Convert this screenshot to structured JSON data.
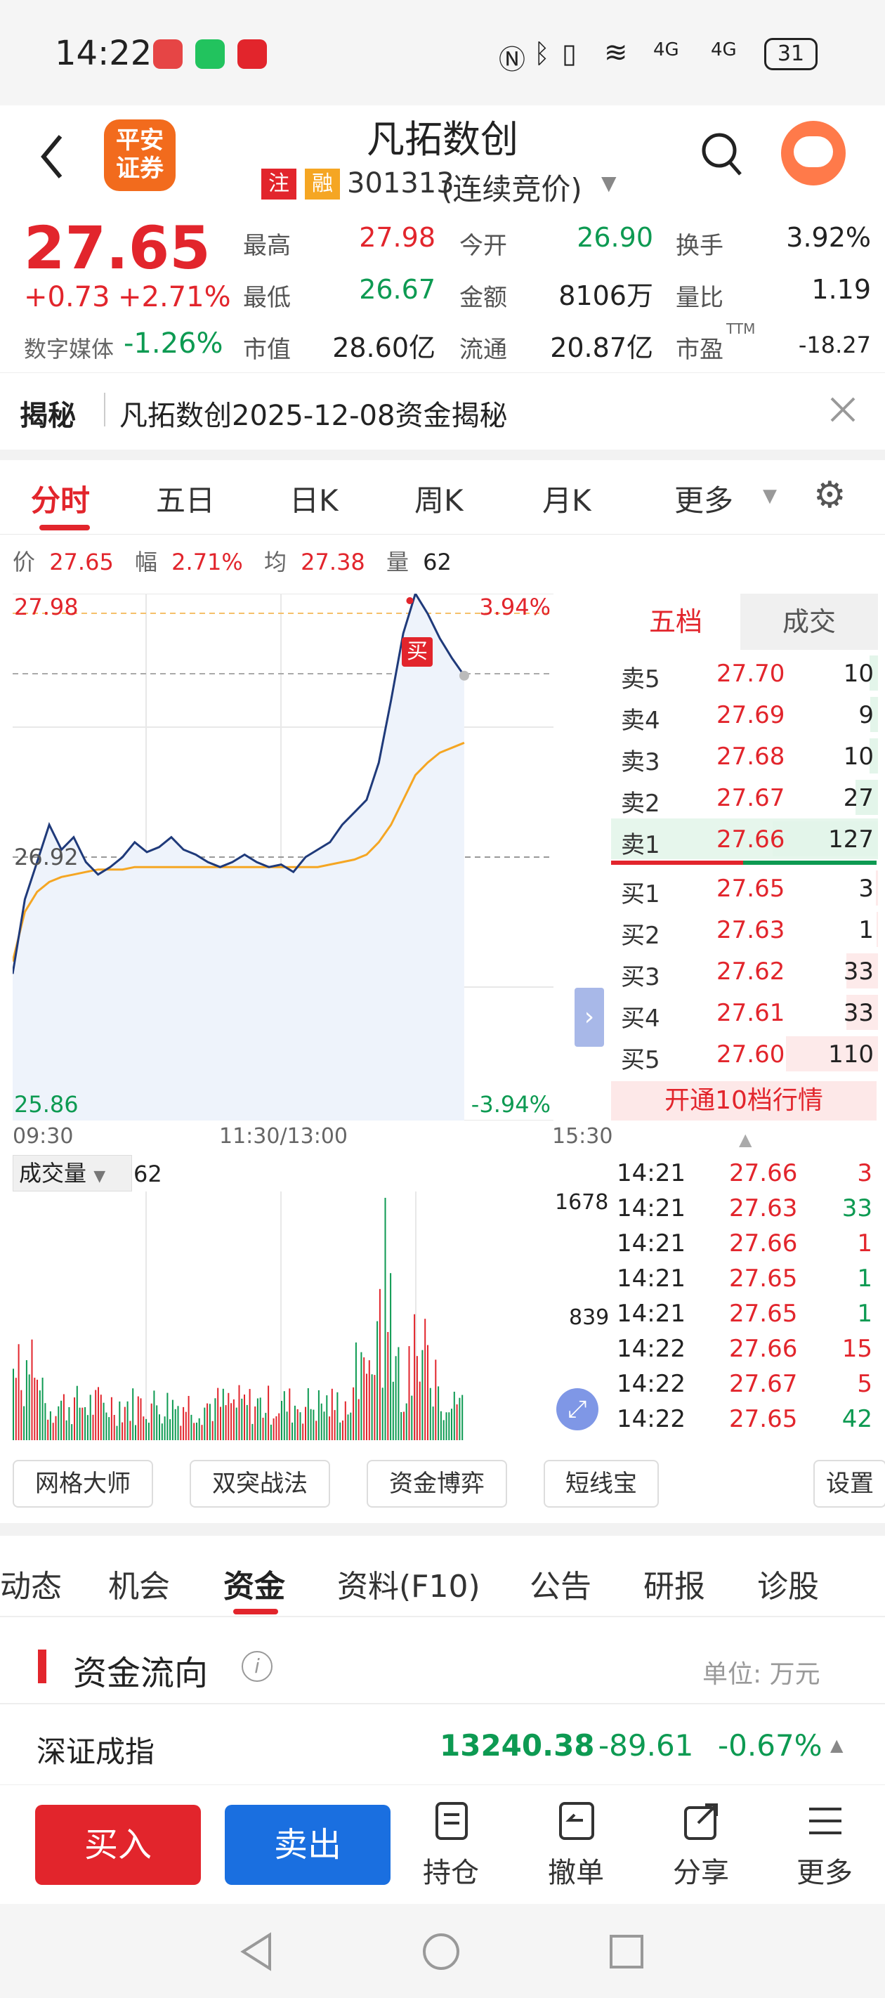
{
  "status": {
    "time": "14:22",
    "battery": "31",
    "signal_a": "4G",
    "signal_b": "4G"
  },
  "header": {
    "title": "凡拓数创",
    "tag_a": "注",
    "tag_b": "融",
    "code": "301313",
    "status": "(连续竞价)",
    "logo_line1": "平安",
    "logo_line2": "证券"
  },
  "quote": {
    "price": "27.65",
    "change": "+0.73",
    "change_pct": "+2.71%",
    "sector_label": "数字媒体",
    "sector_change": "-1.26%",
    "high_label": "最高",
    "high": "27.98",
    "open_label": "今开",
    "open": "26.90",
    "turnover_label": "换手",
    "turnover": "3.92%",
    "low_label": "最低",
    "low": "26.67",
    "amount_label": "金额",
    "amount": "8106万",
    "volratio_label": "量比",
    "volratio": "1.19",
    "mktcap_label": "市值",
    "mktcap": "28.60亿",
    "float_label": "流通",
    "float": "20.87亿",
    "pe_label": "市盈",
    "pe_sup": "TTM",
    "pe": "-18.27"
  },
  "banner": {
    "label": "揭秘",
    "text": "凡拓数创2025-12-08资金揭秘"
  },
  "chart_tabs": [
    "分时",
    "五日",
    "日K",
    "周K",
    "月K",
    "更多"
  ],
  "infobar": {
    "price_label": "价",
    "price": "27.65",
    "range_label": "幅",
    "range": "2.71%",
    "avg_label": "均",
    "avg": "27.38",
    "vol_label": "量",
    "vol": "62"
  },
  "chart": {
    "y_top": "27.98",
    "y_mid": "26.92",
    "y_bot": "25.86",
    "pct_top": "3.94%",
    "pct_bot": "-3.94%",
    "x_start": "09:30",
    "x_mid": "11:30/13:00",
    "x_end": "15:30",
    "buy_marker": "买",
    "vol_label": "成交量",
    "vol_value": "62",
    "vol_max": "1678",
    "vol_mid": "839"
  },
  "chart_data": {
    "type": "line",
    "title": "",
    "ylim": [
      25.86,
      27.98
    ],
    "x": [
      "09:30",
      "11:30/13:00",
      "15:30"
    ],
    "series": [
      {
        "name": "价",
        "values": [
          26.45,
          26.75,
          26.9,
          27.05,
          26.95,
          27.0,
          26.9,
          26.85,
          26.88,
          26.92,
          26.98,
          26.94,
          26.96,
          27.0,
          26.95,
          26.93,
          26.9,
          26.88,
          26.9,
          26.93,
          26.9,
          26.88,
          26.89,
          26.86,
          26.92,
          26.95,
          26.98,
          27.05,
          27.1,
          27.15,
          27.3,
          27.55,
          27.82,
          27.98,
          27.9,
          27.8,
          27.72,
          27.65
        ]
      },
      {
        "name": "均",
        "values": [
          26.5,
          26.7,
          26.78,
          26.82,
          26.84,
          26.85,
          26.86,
          26.87,
          26.87,
          26.87,
          26.88,
          26.88,
          26.88,
          26.88,
          26.88,
          26.88,
          26.88,
          26.88,
          26.88,
          26.88,
          26.88,
          26.88,
          26.88,
          26.88,
          26.88,
          26.88,
          26.89,
          26.9,
          26.91,
          26.93,
          26.98,
          27.05,
          27.15,
          27.25,
          27.3,
          27.34,
          27.36,
          27.38
        ]
      }
    ]
  },
  "orderbook": {
    "tab_a": "五档",
    "tab_b": "成交",
    "asks": [
      {
        "label": "卖5",
        "price": "27.70",
        "vol": "10",
        "bar": 0.08
      },
      {
        "label": "卖4",
        "price": "27.69",
        "vol": "9",
        "bar": 0.07
      },
      {
        "label": "卖3",
        "price": "27.68",
        "vol": "10",
        "bar": 0.08
      },
      {
        "label": "卖2",
        "price": "27.67",
        "vol": "27",
        "bar": 0.21
      },
      {
        "label": "卖1",
        "price": "27.66",
        "vol": "127",
        "bar": 1.0
      }
    ],
    "bids": [
      {
        "label": "买1",
        "price": "27.65",
        "vol": "3",
        "bar": 0.02
      },
      {
        "label": "买2",
        "price": "27.63",
        "vol": "1",
        "bar": 0.01
      },
      {
        "label": "买3",
        "price": "27.62",
        "vol": "33",
        "bar": 0.3
      },
      {
        "label": "买4",
        "price": "27.61",
        "vol": "33",
        "bar": 0.3
      },
      {
        "label": "买5",
        "price": "27.60",
        "vol": "110",
        "bar": 0.87
      }
    ],
    "upgrade": "开通10档行情"
  },
  "trades": [
    {
      "time": "14:21",
      "price": "27.66",
      "vol": "3",
      "dir": "up"
    },
    {
      "time": "14:21",
      "price": "27.63",
      "vol": "33",
      "dir": "down"
    },
    {
      "time": "14:21",
      "price": "27.66",
      "vol": "1",
      "dir": "up"
    },
    {
      "time": "14:21",
      "price": "27.65",
      "vol": "1",
      "dir": "down"
    },
    {
      "time": "14:21",
      "price": "27.65",
      "vol": "1",
      "dir": "down"
    },
    {
      "time": "14:22",
      "price": "27.66",
      "vol": "15",
      "dir": "up"
    },
    {
      "time": "14:22",
      "price": "27.67",
      "vol": "5",
      "dir": "up"
    },
    {
      "time": "14:22",
      "price": "27.65",
      "vol": "42",
      "dir": "down"
    }
  ],
  "tools": [
    "网格大师",
    "双突战法",
    "资金博弈",
    "短线宝",
    "设置"
  ],
  "news_tabs": [
    "动态",
    "机会",
    "资金",
    "资料(F10)",
    "公告",
    "研报",
    "诊股"
  ],
  "fund": {
    "title": "资金流向",
    "unit": "单位: 万元"
  },
  "index": {
    "name": "深证成指",
    "value": "13240.38",
    "change": "-89.61",
    "pct": "-0.67%"
  },
  "bottom": {
    "buy": "买入",
    "sell": "卖出",
    "hold": "持仓",
    "cancel": "撤单",
    "share": "分享",
    "more": "更多"
  },
  "colors": {
    "up": "#e2252c",
    "down": "#0d9a52",
    "price_line": "#1f3a7a",
    "avg_line": "#f5a623",
    "buy_btn": "#e2252c",
    "sell_btn": "#1a6fe0"
  }
}
